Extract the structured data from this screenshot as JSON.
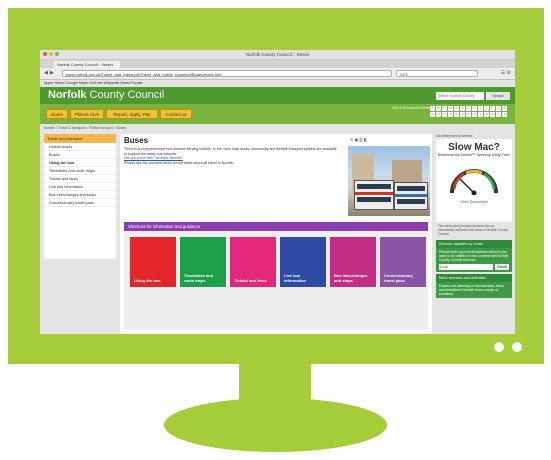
{
  "browser": {
    "window_title": "Norfolk County Council :: Buses",
    "tab_label": "Norfolk County Council :: Buses",
    "url": "www.norfolk.gov.uk/Travel_and_transport/Travel_and_public_transport/Buses/index.htm",
    "search_engine": "NCF",
    "bookmarks_text": "Apple  Yahoo!  Google Maps  YouTube  Wikipedia  News  Popular"
  },
  "site": {
    "logo_bold": "Norfolk",
    "logo_light": " County Council",
    "search_placeholder": "Search Norfolk County",
    "search_button": "Search",
    "nav": [
      "Home",
      "Places I live",
      "Report, Apply, Pay",
      "Contact us"
    ],
    "az_label": "A to Z of Council Services",
    "az_letters": [
      "A",
      "B",
      "C",
      "D",
      "E",
      "F",
      "G",
      "H",
      "I",
      "J",
      "K",
      "L",
      "M",
      "N",
      "O",
      "P",
      "Q",
      "R",
      "S",
      "T",
      "U",
      "V",
      "W",
      "X",
      "Y",
      "Z"
    ],
    "breadcrumb": "Norfolk > Travel & transport > Public transport > Buses"
  },
  "left_nav": {
    "heading": "Travel and transport",
    "items": [
      "Norfolk buses",
      "Buses",
      "Using the bus",
      "Timetables and route maps",
      "Tickets and fares",
      "Live bus information",
      "Bus interchanges and stops",
      "Concessionary travel pass"
    ]
  },
  "main": {
    "title": "Buses",
    "intro": "There is a comprehensive bus network serving Norfolk. In the more rural areas, community and flexible transport options are available to support the wider bus network.",
    "link": "Did you know with Traveline Norfolk?",
    "note": "Please see the sources below for the latest about all travel in Norfolk.",
    "tools": "✉ ▣ ⎙ ◧",
    "services_heading": "Shortcuts for information and guidance",
    "services": [
      {
        "label": "Using the bus",
        "color": "#e3262b"
      },
      {
        "label": "Timetables and route maps",
        "color": "#1ea04a"
      },
      {
        "label": "Tickets and fares",
        "color": "#e4297b"
      },
      {
        "label": "Live bus information",
        "color": "#2d4aa5"
      },
      {
        "label": "Bus interchanges and stops",
        "color": "#c22d86"
      },
      {
        "label": "Concessionary travel pass",
        "color": "#8b55a5"
      }
    ]
  },
  "right_col": {
    "ad_label": "Advertisement    Advertise",
    "ad_title": "Slow Mac?",
    "ad_sub": "Download the Norton™ Speedup Utility Free!",
    "ad_cta": "Free Download",
    "ad_foot": "The views and products featured do not necessarily represent the views of Norfolk County Council.",
    "email_heading": "Receive updates by email",
    "email_text": "Please enter your email address below if you want to be notified of new content with Norfolk County Council services.",
    "email_placeholder": "Email",
    "email_button": "Submit",
    "more_heading": "More services and activities",
    "more_text": "Explore our directory to find services, clubs and activities in Norfolk from a range of providers."
  }
}
